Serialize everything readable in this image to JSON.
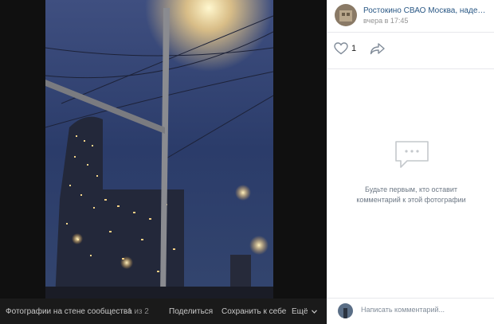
{
  "colors": {
    "link": "#2a5885",
    "muted": "#939393",
    "sky": "#2b3c6a"
  },
  "footer_bar": {
    "album": "Фотографии на стене сообщества",
    "counter": "1 из 2",
    "share": "Поделиться",
    "save": "Сохранить к себе",
    "more": "Ещё"
  },
  "post": {
    "author": "Ростокино СВАО Москва, наденька м...",
    "time": "вчера в 17:45",
    "likes": "1"
  },
  "comments": {
    "empty_line1": "Будьте первым, кто оставит",
    "empty_line2": "комментарий к этой фотографии",
    "placeholder": "Написать комментарий..."
  },
  "icons": [
    "heart-icon",
    "share-arrow-icon",
    "comments-bubble-icon",
    "chevron-down-icon"
  ]
}
